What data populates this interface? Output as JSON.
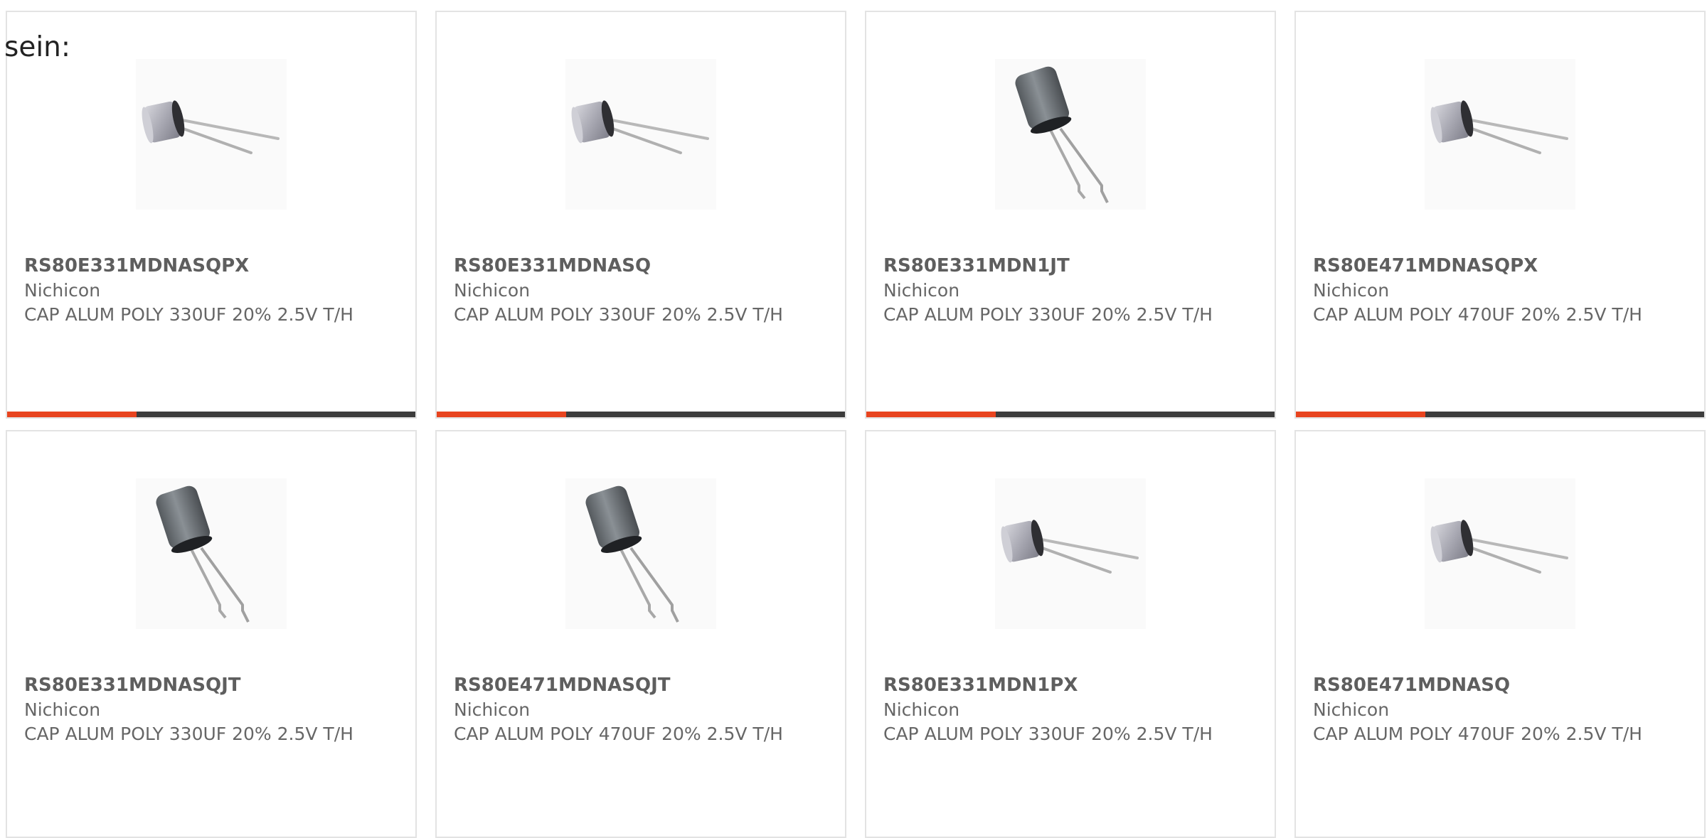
{
  "intro_text": "sein:",
  "colors": {
    "accent": "#e8441f",
    "bar": "#3c3c3c",
    "border": "#e3e3e3"
  },
  "products": [
    {
      "part_number": "RS80E331MDNASQPX",
      "manufacturer": "Nichicon",
      "description": "CAP ALUM POLY 330UF 20% 2.5V T/H",
      "image": "capacitor-horizontal-silver-icon",
      "show_bar": true
    },
    {
      "part_number": "RS80E331MDNASQ",
      "manufacturer": "Nichicon",
      "description": "CAP ALUM POLY 330UF 20% 2.5V T/H",
      "image": "capacitor-horizontal-silver-icon",
      "show_bar": true
    },
    {
      "part_number": "RS80E331MDN1JT",
      "manufacturer": "Nichicon",
      "description": "CAP ALUM POLY 330UF 20% 2.5V T/H",
      "image": "capacitor-vertical-dark-icon",
      "show_bar": true
    },
    {
      "part_number": "RS80E471MDNASQPX",
      "manufacturer": "Nichicon",
      "description": "CAP ALUM POLY 470UF 20% 2.5V T/H",
      "image": "capacitor-horizontal-silver-icon",
      "show_bar": true
    },
    {
      "part_number": "RS80E331MDNASQJT",
      "manufacturer": "Nichicon",
      "description": "CAP ALUM POLY 330UF 20% 2.5V T/H",
      "image": "capacitor-vertical-dark-icon",
      "show_bar": false
    },
    {
      "part_number": "RS80E471MDNASQJT",
      "manufacturer": "Nichicon",
      "description": "CAP ALUM POLY 470UF 20% 2.5V T/H",
      "image": "capacitor-vertical-dark-icon",
      "show_bar": false
    },
    {
      "part_number": "RS80E331MDN1PX",
      "manufacturer": "Nichicon",
      "description": "CAP ALUM POLY 330UF 20% 2.5V T/H",
      "image": "capacitor-horizontal-silver-icon",
      "show_bar": false
    },
    {
      "part_number": "RS80E471MDNASQ",
      "manufacturer": "Nichicon",
      "description": "CAP ALUM POLY 470UF 20% 2.5V T/H",
      "image": "capacitor-horizontal-silver-icon",
      "show_bar": false
    }
  ]
}
